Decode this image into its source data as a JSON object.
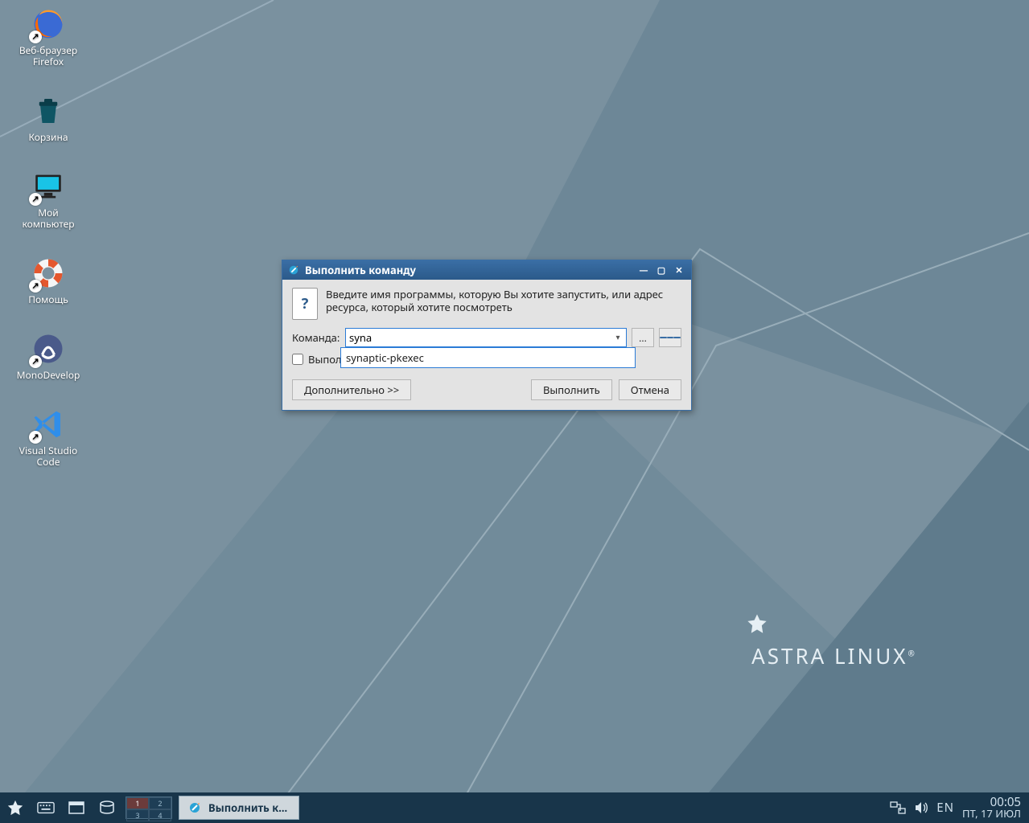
{
  "desktop": {
    "icons": [
      {
        "name": "firefox",
        "label": "Веб-браузер\nFirefox",
        "shortcut": true
      },
      {
        "name": "trash",
        "label": "Корзина",
        "shortcut": false
      },
      {
        "name": "mycomputer",
        "label": "Мой\nкомпьютер",
        "shortcut": true
      },
      {
        "name": "help",
        "label": "Помощь",
        "shortcut": true
      },
      {
        "name": "monodevelop",
        "label": "MonoDevelop",
        "shortcut": true
      },
      {
        "name": "vscode",
        "label": "Visual Studio\nCode",
        "shortcut": true
      }
    ],
    "brand": "ASTRA LINUX"
  },
  "dialog": {
    "title": "Выполнить команду",
    "instruction": "Введите имя программы, которую Вы хотите запустить, или адрес ресурса, который хотите посмотреть",
    "command_label": "Команда:",
    "command_value": "syna",
    "autocomplete_suggestion": "synaptic-pkexec",
    "browse_button": "...",
    "run_in_terminal_checkbox_label_visible": "Выпол",
    "run_in_terminal_checked": false,
    "advanced_button": "Дополнительно >>",
    "ok_button": "Выполнить",
    "cancel_button": "Отмена"
  },
  "taskbar": {
    "workspaces": [
      "1",
      "2",
      "3",
      "4"
    ],
    "active_workspace": 0,
    "task_label": "Выполнить к...",
    "lang": "EN",
    "time": "00:05",
    "date": "ПТ, 17 ИЮЛ"
  }
}
